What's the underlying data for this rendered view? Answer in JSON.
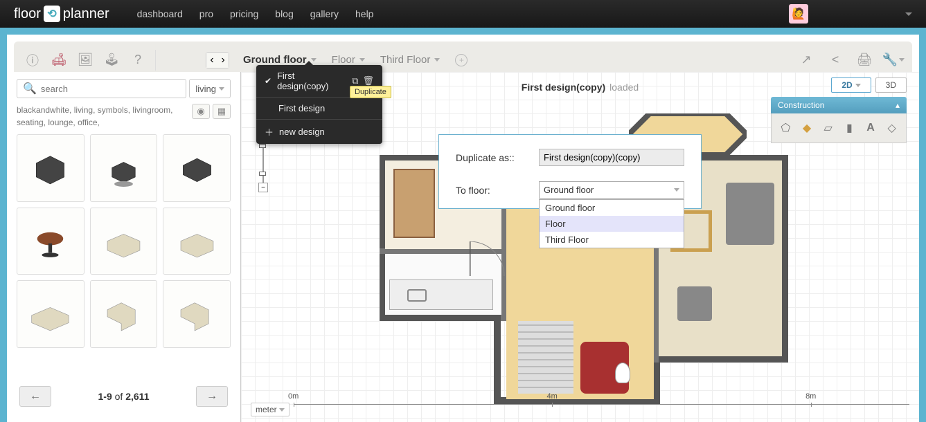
{
  "topnav": {
    "logo_left": "floor",
    "logo_right": "planner",
    "links": [
      "dashboard",
      "pro",
      "pricing",
      "blog",
      "gallery",
      "help"
    ]
  },
  "toolbar": {
    "floors": [
      {
        "label": "Ground floor",
        "active": true
      },
      {
        "label": "Floor",
        "active": false
      },
      {
        "label": "Third Floor",
        "active": false
      }
    ]
  },
  "design_menu": {
    "items": [
      {
        "label": "First design(copy)",
        "checked": true,
        "has_actions": true
      },
      {
        "label": "First design",
        "checked": false,
        "has_actions": false
      }
    ],
    "new_label": "new design",
    "tooltip": "Duplicate"
  },
  "sidebar": {
    "search_placeholder": "search",
    "category": "living",
    "tags": "blackandwhite, living, symbols, livingroom, seating, lounge, office,",
    "pager": {
      "range": "1-9",
      "of_word": "of",
      "total": "2,611"
    }
  },
  "canvas": {
    "design_name": "First design(copy)",
    "status": "loaded",
    "unit": "meter",
    "ruler_marks": [
      "0m",
      "4m",
      "8m"
    ]
  },
  "view_toggle": {
    "opt2d": "2D",
    "opt3d": "3D"
  },
  "construction": {
    "title": "Construction"
  },
  "duplicate_dialog": {
    "label_name": "Duplicate as::",
    "value_name": "First design(copy)(copy)",
    "label_floor": "To floor:",
    "selected_floor": "Ground floor",
    "options": [
      "Ground floor",
      "Floor",
      "Third Floor"
    ],
    "highlighted_index": 1
  }
}
